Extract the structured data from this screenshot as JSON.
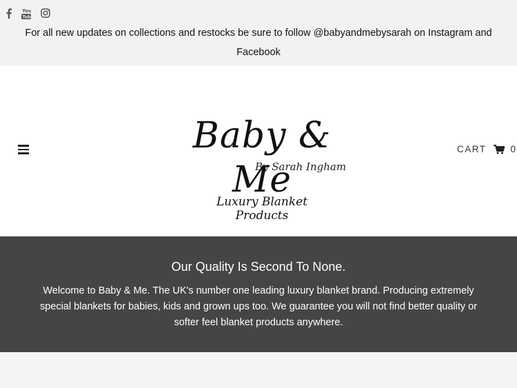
{
  "social": {
    "icons": [
      "facebook-icon",
      "youtube-icon",
      "instagram-icon"
    ],
    "youtube_label": "You Tube"
  },
  "announcement": "For all new updates on collections and restocks be sure to follow @babyandmebysarah on Instagram and Facebook",
  "logo": {
    "main": "Baby & Me",
    "sub": "By Sarah Ingham",
    "tagline": "Luxury Blanket Products"
  },
  "cart": {
    "label": "CART",
    "count": "0",
    "icon": "cart-icon"
  },
  "promo": {
    "heading": "Our Quality Is Second To None.",
    "body": "Welcome to Baby & Me. The UK's number one leading luxury blanket brand. Producing extremely special blankets for babies, kids and grown ups too. We guarantee you will not find better quality or softer feel blanket products anywhere."
  },
  "colors": {
    "topbar_bg": "#f2f2f2",
    "promo_bg": "#454545",
    "promo_text": "#ffffff"
  }
}
